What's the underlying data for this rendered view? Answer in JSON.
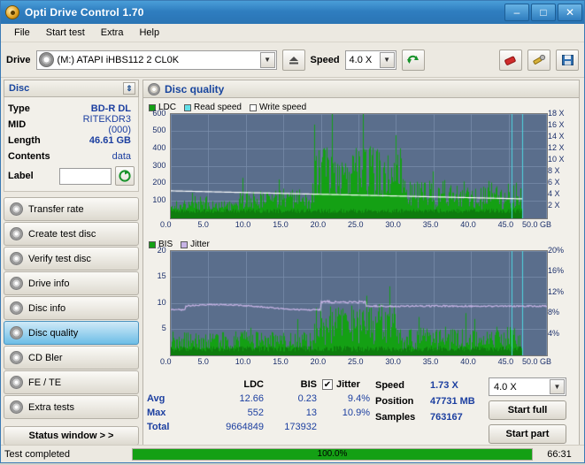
{
  "window": {
    "title": "Opti Drive Control 1.70",
    "icon": "disc-icon",
    "minimize": "–",
    "maximize": "□",
    "close": "✕"
  },
  "menu": [
    "File",
    "Start test",
    "Extra",
    "Help"
  ],
  "toolbar": {
    "drive_label": "Drive",
    "drive_value": "(M:)  ATAPI iHBS112   2 CL0K",
    "eject_icon": "eject-icon",
    "speed_label": "Speed",
    "speed_value": "4.0 X",
    "refresh_icon": "refresh-icon",
    "erase_icon": "eraser-icon",
    "tools_icon": "tools-icon",
    "save_icon": "save-icon"
  },
  "disc_panel": {
    "title": "Disc",
    "pin_icon": "pin-icon",
    "rows": [
      {
        "key": "Type",
        "value": "BD-R DL",
        "strong": true
      },
      {
        "key": "MID",
        "value": "RITEKDR3 (000)",
        "strong": false
      },
      {
        "key": "Length",
        "value": "46.61 GB",
        "strong": true
      },
      {
        "key": "Contents",
        "value": "data",
        "strong": false
      }
    ],
    "label_key": "Label",
    "label_value": "",
    "label_button_icon": "refresh-disc-icon"
  },
  "sidebar": {
    "items": [
      {
        "label": "Transfer rate",
        "active": false
      },
      {
        "label": "Create test disc",
        "active": false
      },
      {
        "label": "Verify test disc",
        "active": false
      },
      {
        "label": "Drive info",
        "active": false
      },
      {
        "label": "Disc info",
        "active": false
      },
      {
        "label": "Disc quality",
        "active": true
      },
      {
        "label": "CD Bler",
        "active": false
      },
      {
        "label": "FE / TE",
        "active": false
      },
      {
        "label": "Extra tests",
        "active": false
      }
    ],
    "status_window": "Status window > >"
  },
  "quality": {
    "header": "Disc quality",
    "legend_top": [
      {
        "label": "LDC",
        "color": "#14a014"
      },
      {
        "label": "Read speed",
        "color": "#63e0e8"
      },
      {
        "label": "Write speed",
        "color": "#ffffff"
      }
    ],
    "legend_bottom": [
      {
        "label": "BIS",
        "color": "#14a014"
      },
      {
        "label": "Jitter",
        "color": "#c8b4e6"
      }
    ]
  },
  "chart_data": [
    {
      "type": "line",
      "title": "LDC / Read speed",
      "xlabel": "GB",
      "ylabel": "LDC",
      "x_ticks": [
        "0.0",
        "5.0",
        "10.0",
        "15.0",
        "20.0",
        "25.0",
        "30.0",
        "35.0",
        "40.0",
        "45.0",
        "50.0 GB"
      ],
      "y_ticks_left": [
        "100",
        "200",
        "300",
        "400",
        "500",
        "600"
      ],
      "y_ticks_right": [
        "2 X",
        "4 X",
        "6 X",
        "8 X",
        "10 X",
        "12 X",
        "14 X",
        "16 X",
        "18 X"
      ],
      "ylim": [
        0,
        600
      ],
      "xlim": [
        0,
        50
      ],
      "grid": true,
      "series": [
        {
          "name": "LDC",
          "color": "#14a014",
          "avg": 12.66,
          "max": 552,
          "total": 9664849
        },
        {
          "name": "Read speed",
          "color": "#ffffff",
          "note": "declining curve from ~4.6X to ~3.3X"
        }
      ]
    },
    {
      "type": "line",
      "title": "BIS / Jitter",
      "xlabel": "GB",
      "ylabel": "BIS",
      "x_ticks": [
        "0.0",
        "5.0",
        "10.0",
        "15.0",
        "20.0",
        "25.0",
        "30.0",
        "35.0",
        "40.0",
        "45.0",
        "50.0 GB"
      ],
      "y_ticks_left": [
        "5",
        "10",
        "15",
        "20"
      ],
      "y_ticks_right": [
        "4%",
        "8%",
        "12%",
        "16%",
        "20%"
      ],
      "ylim": [
        0,
        20
      ],
      "xlim": [
        0,
        50
      ],
      "grid": true,
      "series": [
        {
          "name": "BIS",
          "color": "#14a014",
          "avg": 0.23,
          "max": 13,
          "total": 173932
        },
        {
          "name": "Jitter",
          "color": "#c8b4e6",
          "avg": "9.4%",
          "max": "10.9%"
        }
      ]
    }
  ],
  "stats": {
    "col_headers": [
      "LDC",
      "BIS"
    ],
    "jitter_label": "Jitter",
    "jitter_checked": true,
    "rows": [
      {
        "name": "Avg",
        "ldc": "12.66",
        "bis": "0.23",
        "jitter": "9.4%"
      },
      {
        "name": "Max",
        "ldc": "552",
        "bis": "13",
        "jitter": "10.9%"
      },
      {
        "name": "Total",
        "ldc": "9664849",
        "bis": "173932",
        "jitter": ""
      }
    ]
  },
  "readout": {
    "labels": [
      "Speed",
      "Position",
      "Samples"
    ],
    "values": [
      "1.73 X",
      "47731 MB",
      "763167"
    ],
    "speed_select": "4.0 X",
    "start_full": "Start full",
    "start_part": "Start part"
  },
  "statusbar": {
    "text": "Test completed",
    "progress_pct": "100.0%",
    "progress_value": 100,
    "time": "66:31"
  }
}
